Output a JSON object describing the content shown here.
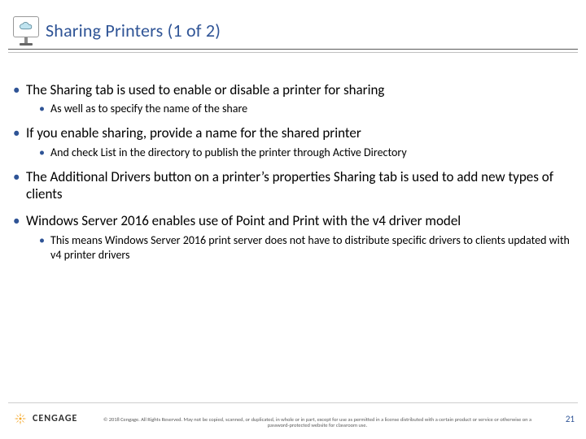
{
  "title": "Sharing Printers (1 of 2)",
  "bullets": [
    {
      "text": "The Sharing tab is used to enable or disable a printer for sharing",
      "sub": [
        "As well as to specify the name of the share"
      ]
    },
    {
      "text": "If you enable sharing, provide a name for the shared printer",
      "sub": [
        "And check List in the directory to publish the printer through Active Directory"
      ]
    },
    {
      "text": "The Additional Drivers button on a printer’s properties Sharing tab is used to add new types of clients",
      "sub": []
    },
    {
      "text": "Windows Server 2016 enables use of Point and Print with the v4 driver model",
      "sub": [
        "This means Windows Server 2016 print server does not have to distribute specific drivers to clients updated with v4 printer drivers"
      ]
    }
  ],
  "footer": {
    "brand": "CENGAGE",
    "copyright": "© 2018 Cengage. All Rights Reserved. May not be copied, scanned, or duplicated, in whole or in part, except for use as permitted in a license distributed with a certain product or service or otherwise on a password-protected website for classroom use.",
    "page": "21"
  }
}
